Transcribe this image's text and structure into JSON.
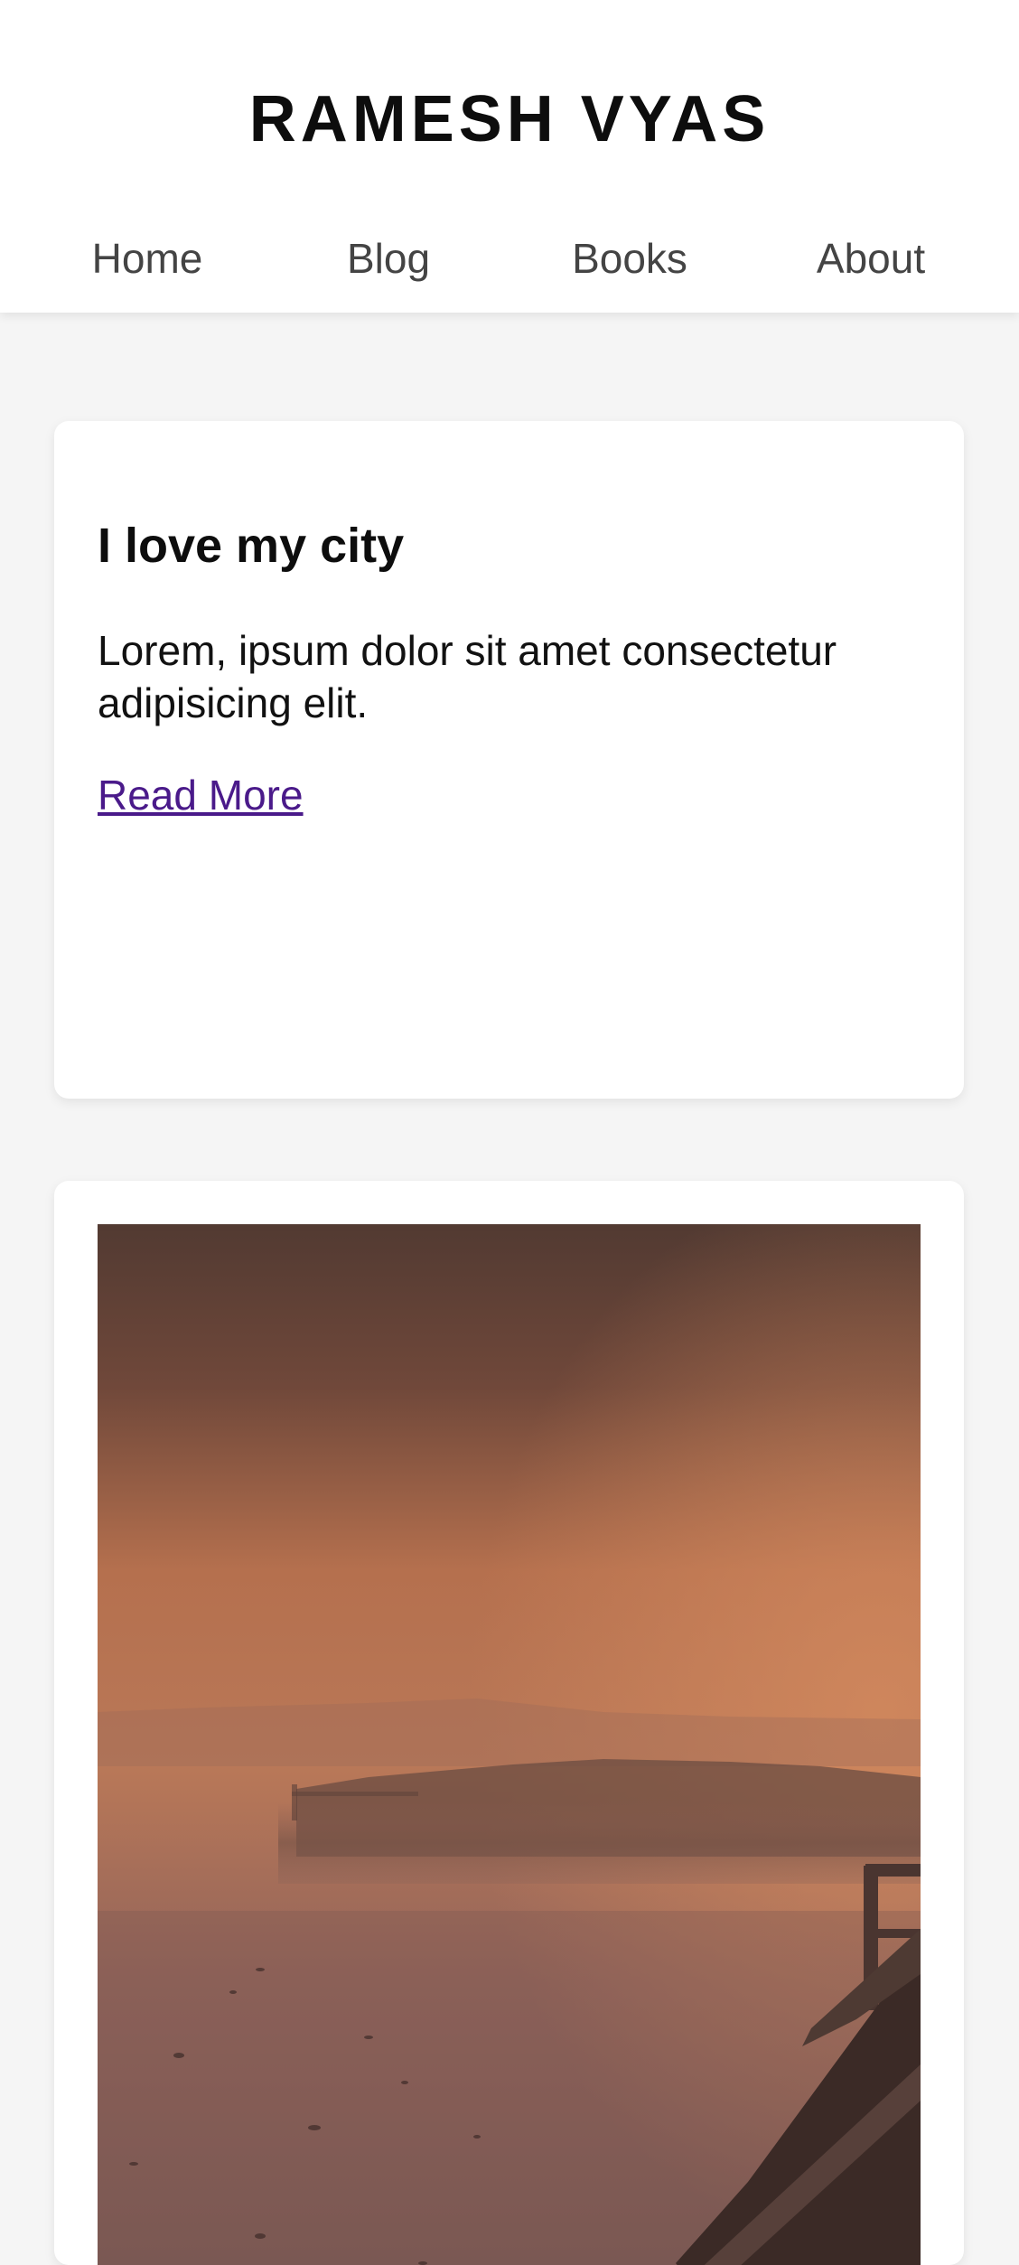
{
  "site": {
    "title": "RAMESH VYAS"
  },
  "nav": {
    "items": [
      {
        "label": "Home"
      },
      {
        "label": "Blog"
      },
      {
        "label": "Books"
      },
      {
        "label": "About"
      }
    ]
  },
  "posts": [
    {
      "title": "I love my city",
      "excerpt": "Lorem, ipsum dolor sit amet consectetur adipisicing elit.",
      "link_label": "Read More"
    },
    {
      "image": "misty-lake-sunrise-with-wooden-pier"
    }
  ],
  "colors": {
    "background": "#f5f5f5",
    "card": "#ffffff",
    "link": "#4a1a8a",
    "title": "#0d0d0d",
    "nav_text": "#444444"
  }
}
